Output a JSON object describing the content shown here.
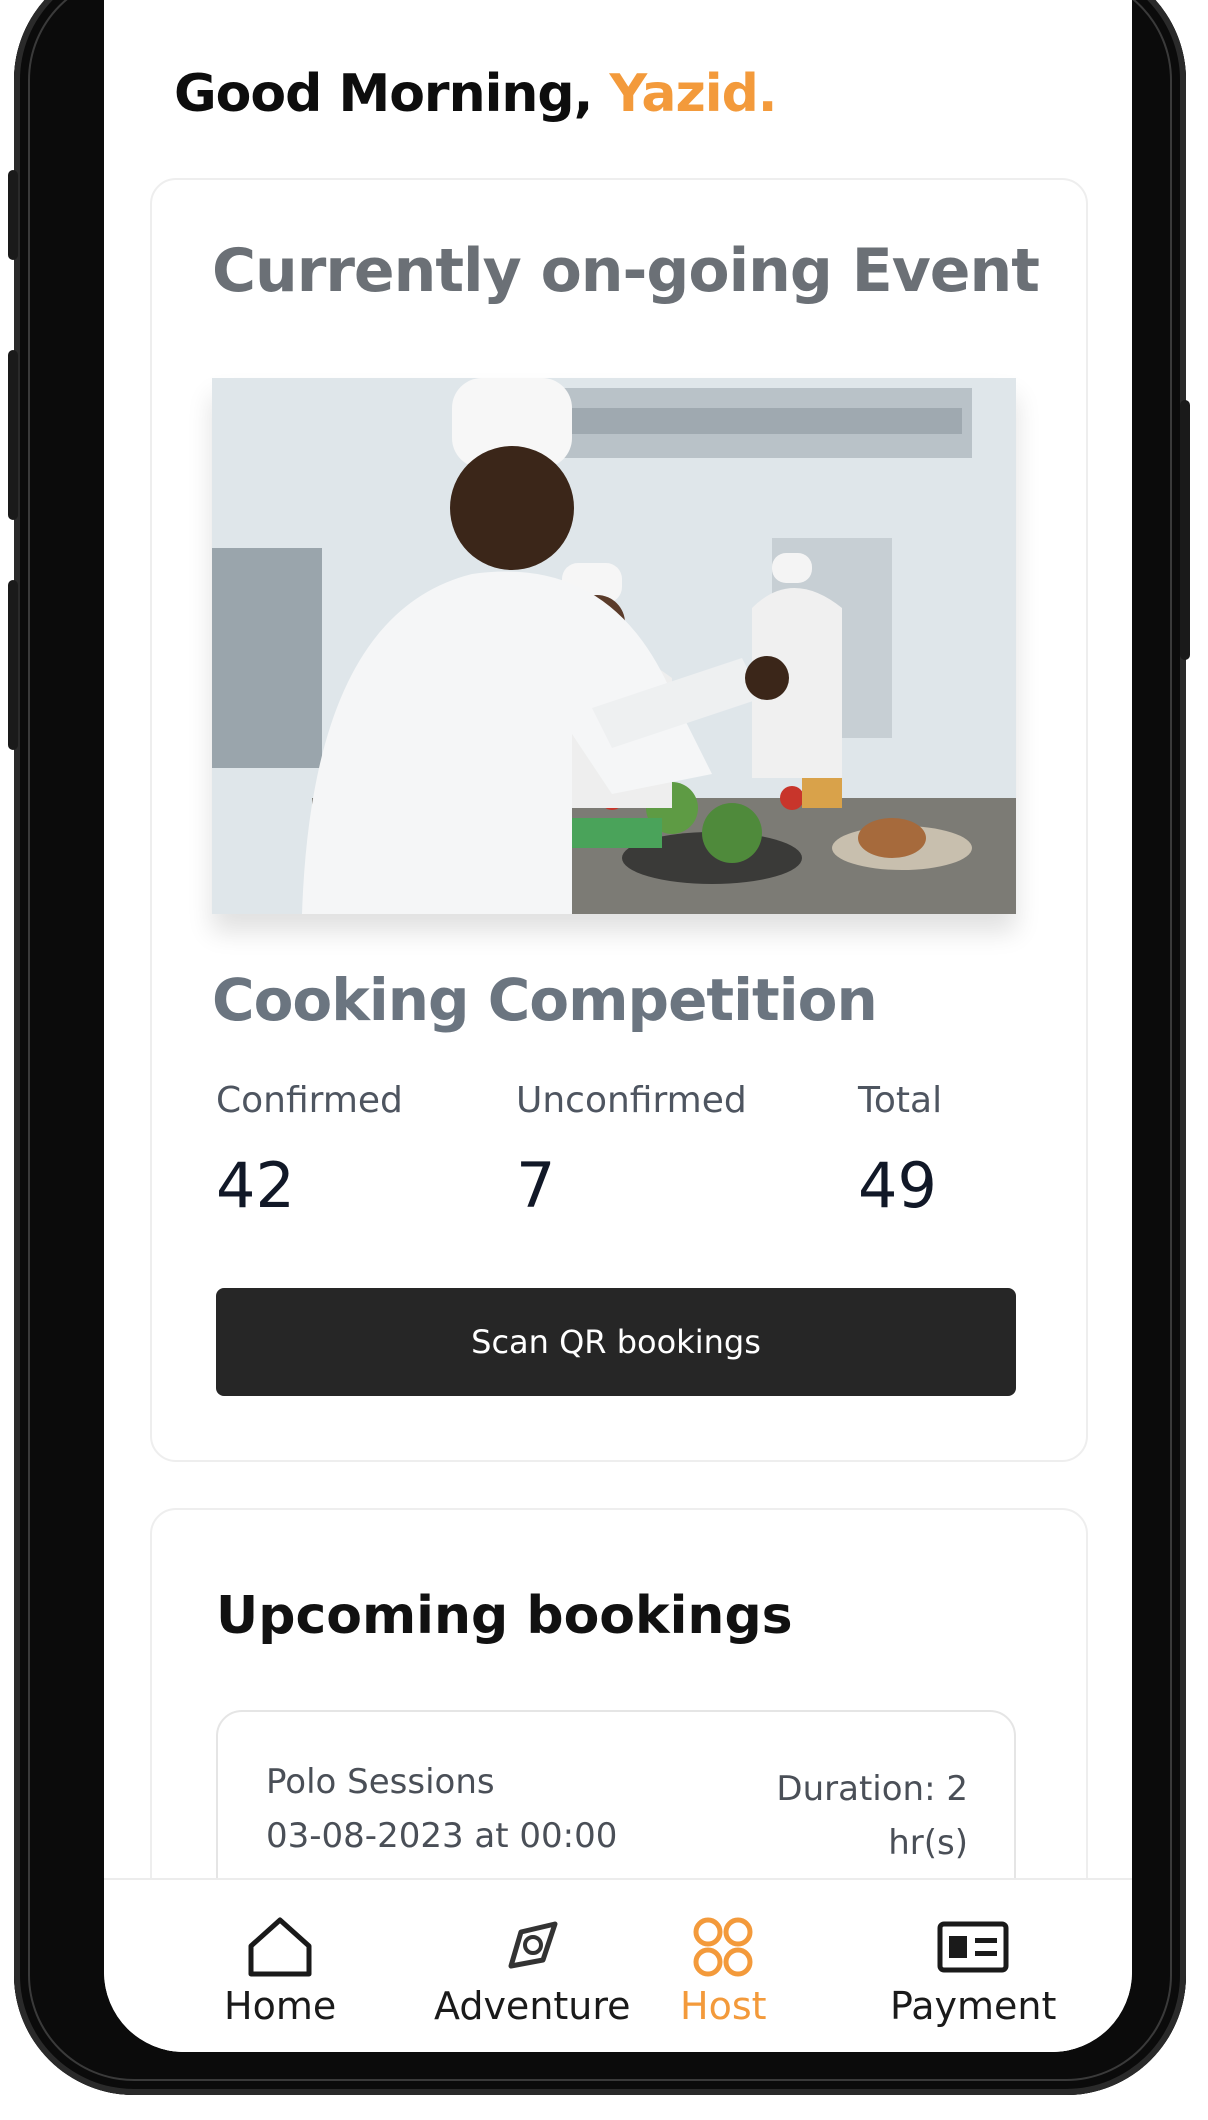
{
  "greeting": {
    "prefix": "Good Morning, ",
    "name": "Yazid."
  },
  "event": {
    "section_title": "Currently on-going Event",
    "name": "Cooking Competition",
    "image_alt": "chef-cooking-photo",
    "stats": [
      {
        "label": "Confirmed",
        "value": "42"
      },
      {
        "label": "Unconfirmed",
        "value": "7"
      },
      {
        "label": "Total",
        "value": "49"
      }
    ],
    "scan_button": "Scan QR bookings"
  },
  "upcoming": {
    "title": "Upcoming bookings",
    "items": [
      {
        "title": "Polo Sessions",
        "date": "03-08-2023 at 00:00",
        "duration": "Duration: 2 hr(s)"
      }
    ]
  },
  "tabbar": {
    "items": [
      {
        "label": "Home",
        "icon": "home-icon"
      },
      {
        "label": "Adventure",
        "icon": "compass-icon"
      },
      {
        "label": "Host",
        "icon": "grid-circles-icon",
        "active": true
      },
      {
        "label": "Payment",
        "icon": "card-icon"
      }
    ]
  },
  "colors": {
    "accent": "#f39a3b",
    "title_gray": "#6b7076",
    "button_dark": "#262626"
  }
}
